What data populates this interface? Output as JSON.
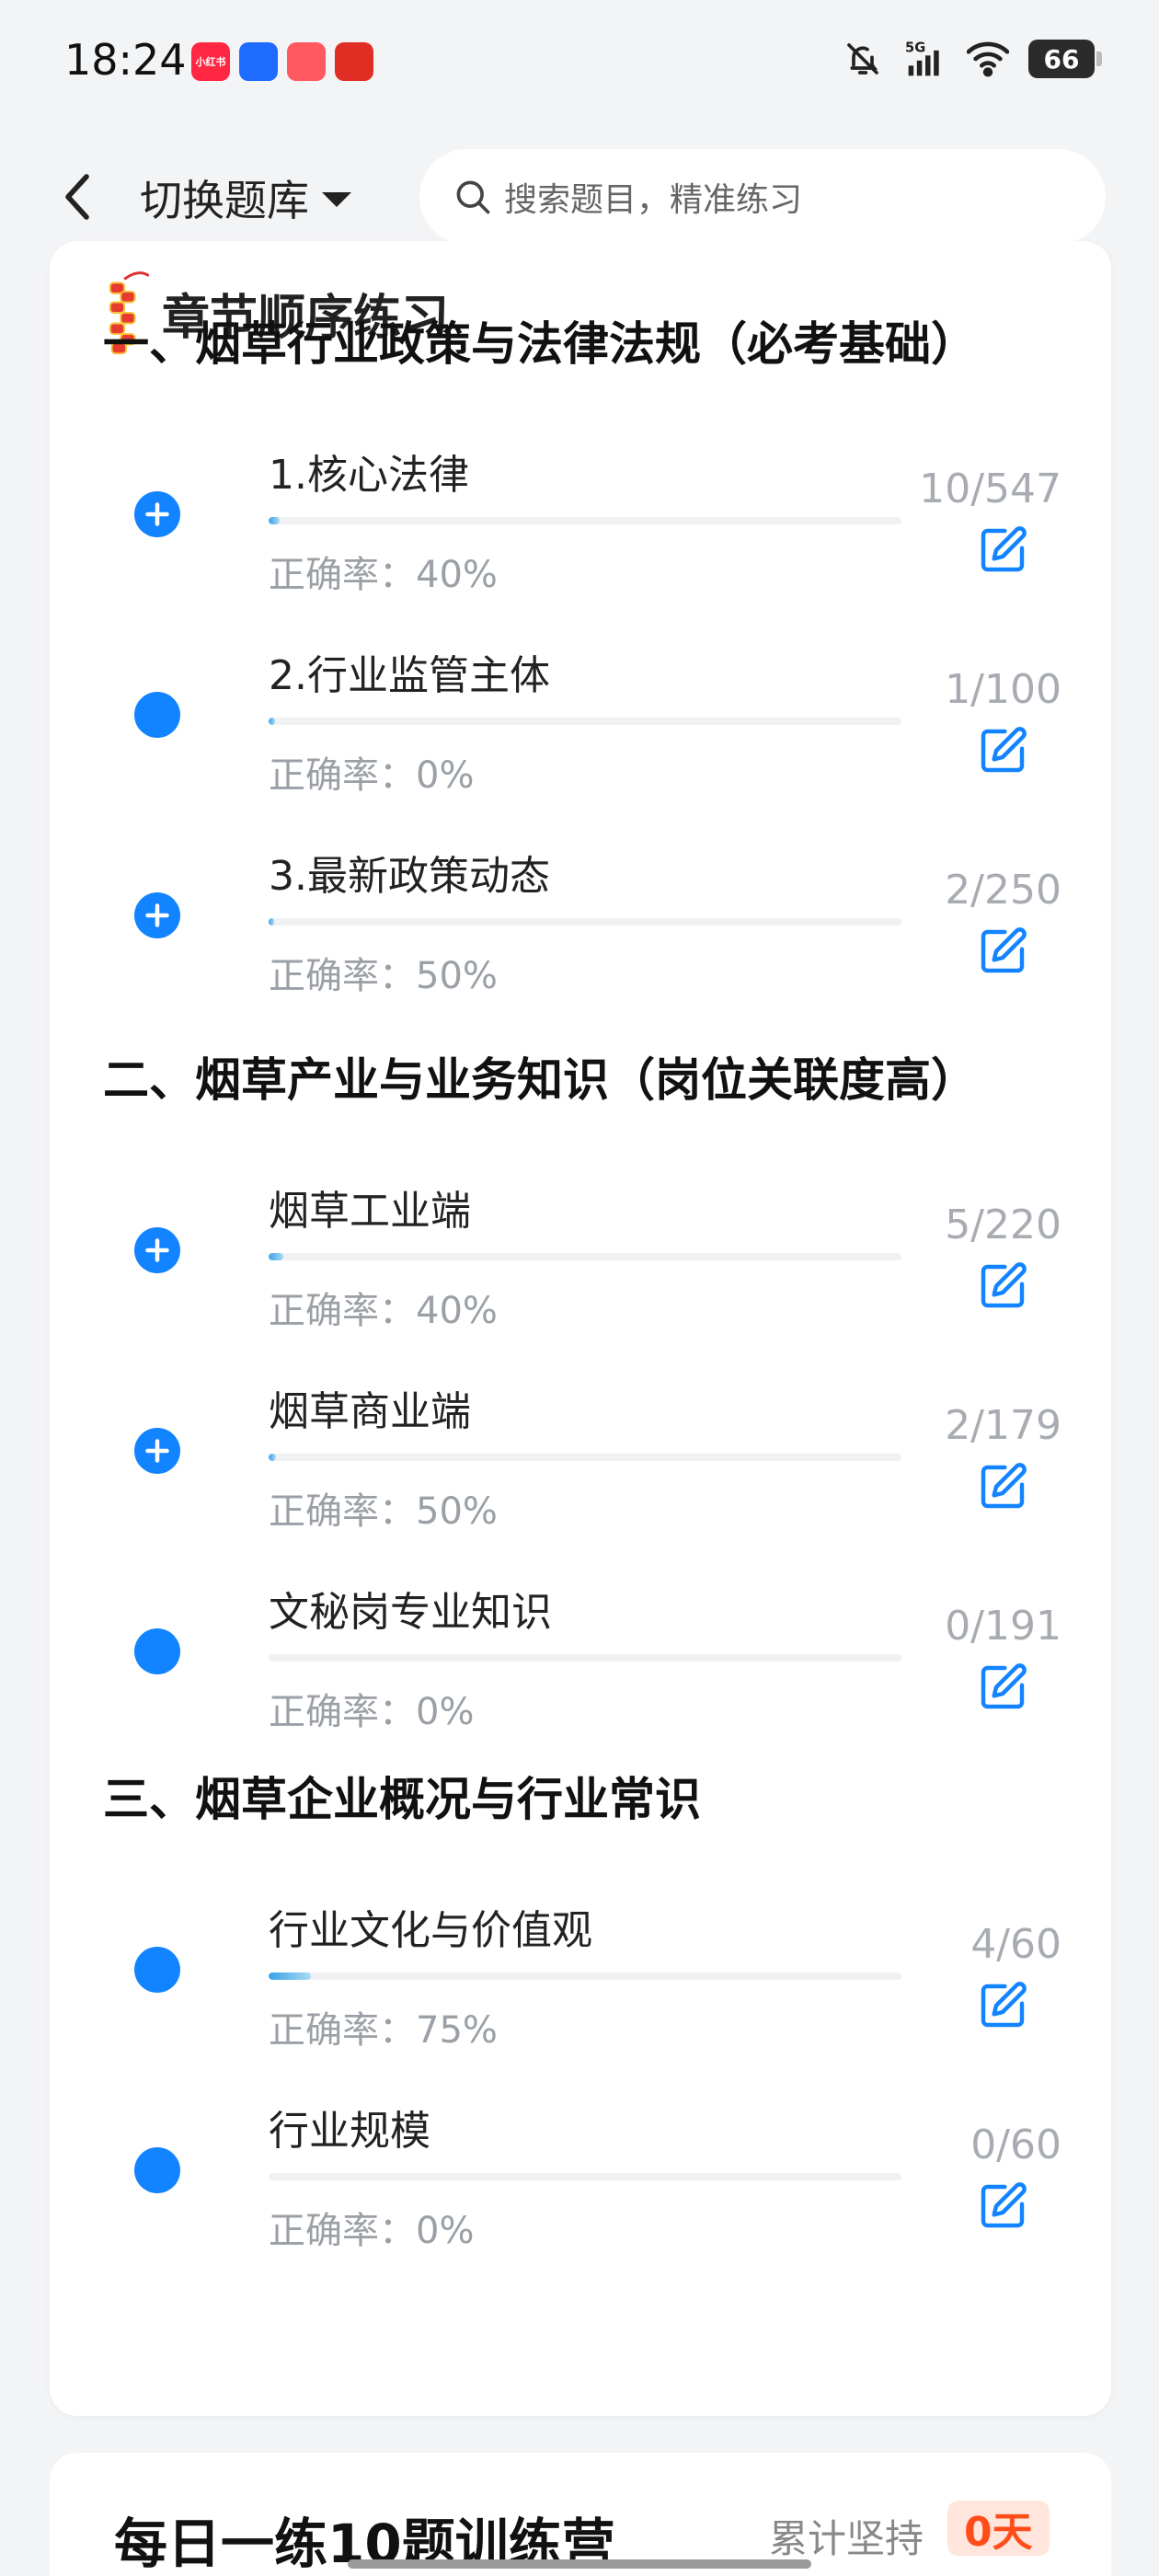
{
  "status_bar": {
    "time": "18:24",
    "app_icons": [
      {
        "name": "xiaohongshu-app-icon",
        "label": "小红书",
        "color": "#ff2741"
      },
      {
        "name": "tool-app-icon",
        "label": "",
        "color": "#1f6bff"
      },
      {
        "name": "kuaikan-app-icon",
        "label": "",
        "color": "#ff5a5f"
      },
      {
        "name": "pinduoduo-app-icon",
        "label": "",
        "color": "#e02e24"
      }
    ],
    "battery": "66",
    "network": "5G"
  },
  "header": {
    "switch_label": "切换题库",
    "search_placeholder": "搜索题目，精准练习"
  },
  "practice": {
    "title": "章节顺序练习",
    "sections": [
      {
        "title": "一、烟草行业政策与法律法规（必考基础）",
        "items": [
          {
            "name": "1.核心法律",
            "rate": "正确率：40%",
            "count": "10/547",
            "progress": 0.018,
            "bullet": "plus"
          },
          {
            "name": "2.行业监管主体",
            "rate": "正确率：0%",
            "count": "1/100",
            "progress": 0.01,
            "bullet": "dot"
          },
          {
            "name": "3.最新政策动态",
            "rate": "正确率：50%",
            "count": "2/250",
            "progress": 0.008,
            "bullet": "plus"
          }
        ]
      },
      {
        "title": "二、烟草产业与业务知识（岗位关联度高）",
        "items": [
          {
            "name": "烟草工业端",
            "rate": "正确率：40%",
            "count": "5/220",
            "progress": 0.023,
            "bullet": "plus"
          },
          {
            "name": "烟草商业端",
            "rate": "正确率：50%",
            "count": "2/179",
            "progress": 0.011,
            "bullet": "plus"
          },
          {
            "name": "文秘岗专业知识",
            "rate": "正确率：0%",
            "count": "0/191",
            "progress": 0,
            "bullet": "dot"
          }
        ]
      },
      {
        "title": "三、烟草企业概况与行业常识",
        "items": [
          {
            "name": "行业文化与价值观",
            "rate": "正确率：75%",
            "count": "4/60",
            "progress": 0.067,
            "bullet": "dot"
          },
          {
            "name": "行业规模",
            "rate": "正确率：0%",
            "count": "0/60",
            "progress": 0,
            "bullet": "dot"
          }
        ]
      }
    ]
  },
  "camp": {
    "title": "每日一练10题训练营",
    "persist_label": "累计坚持",
    "days": "0天"
  },
  "colors": {
    "accent": "#1384ff",
    "highlight": "#cfe6fb",
    "days_bg": "#ffe5dc",
    "days_text": "#ff4d1a"
  }
}
